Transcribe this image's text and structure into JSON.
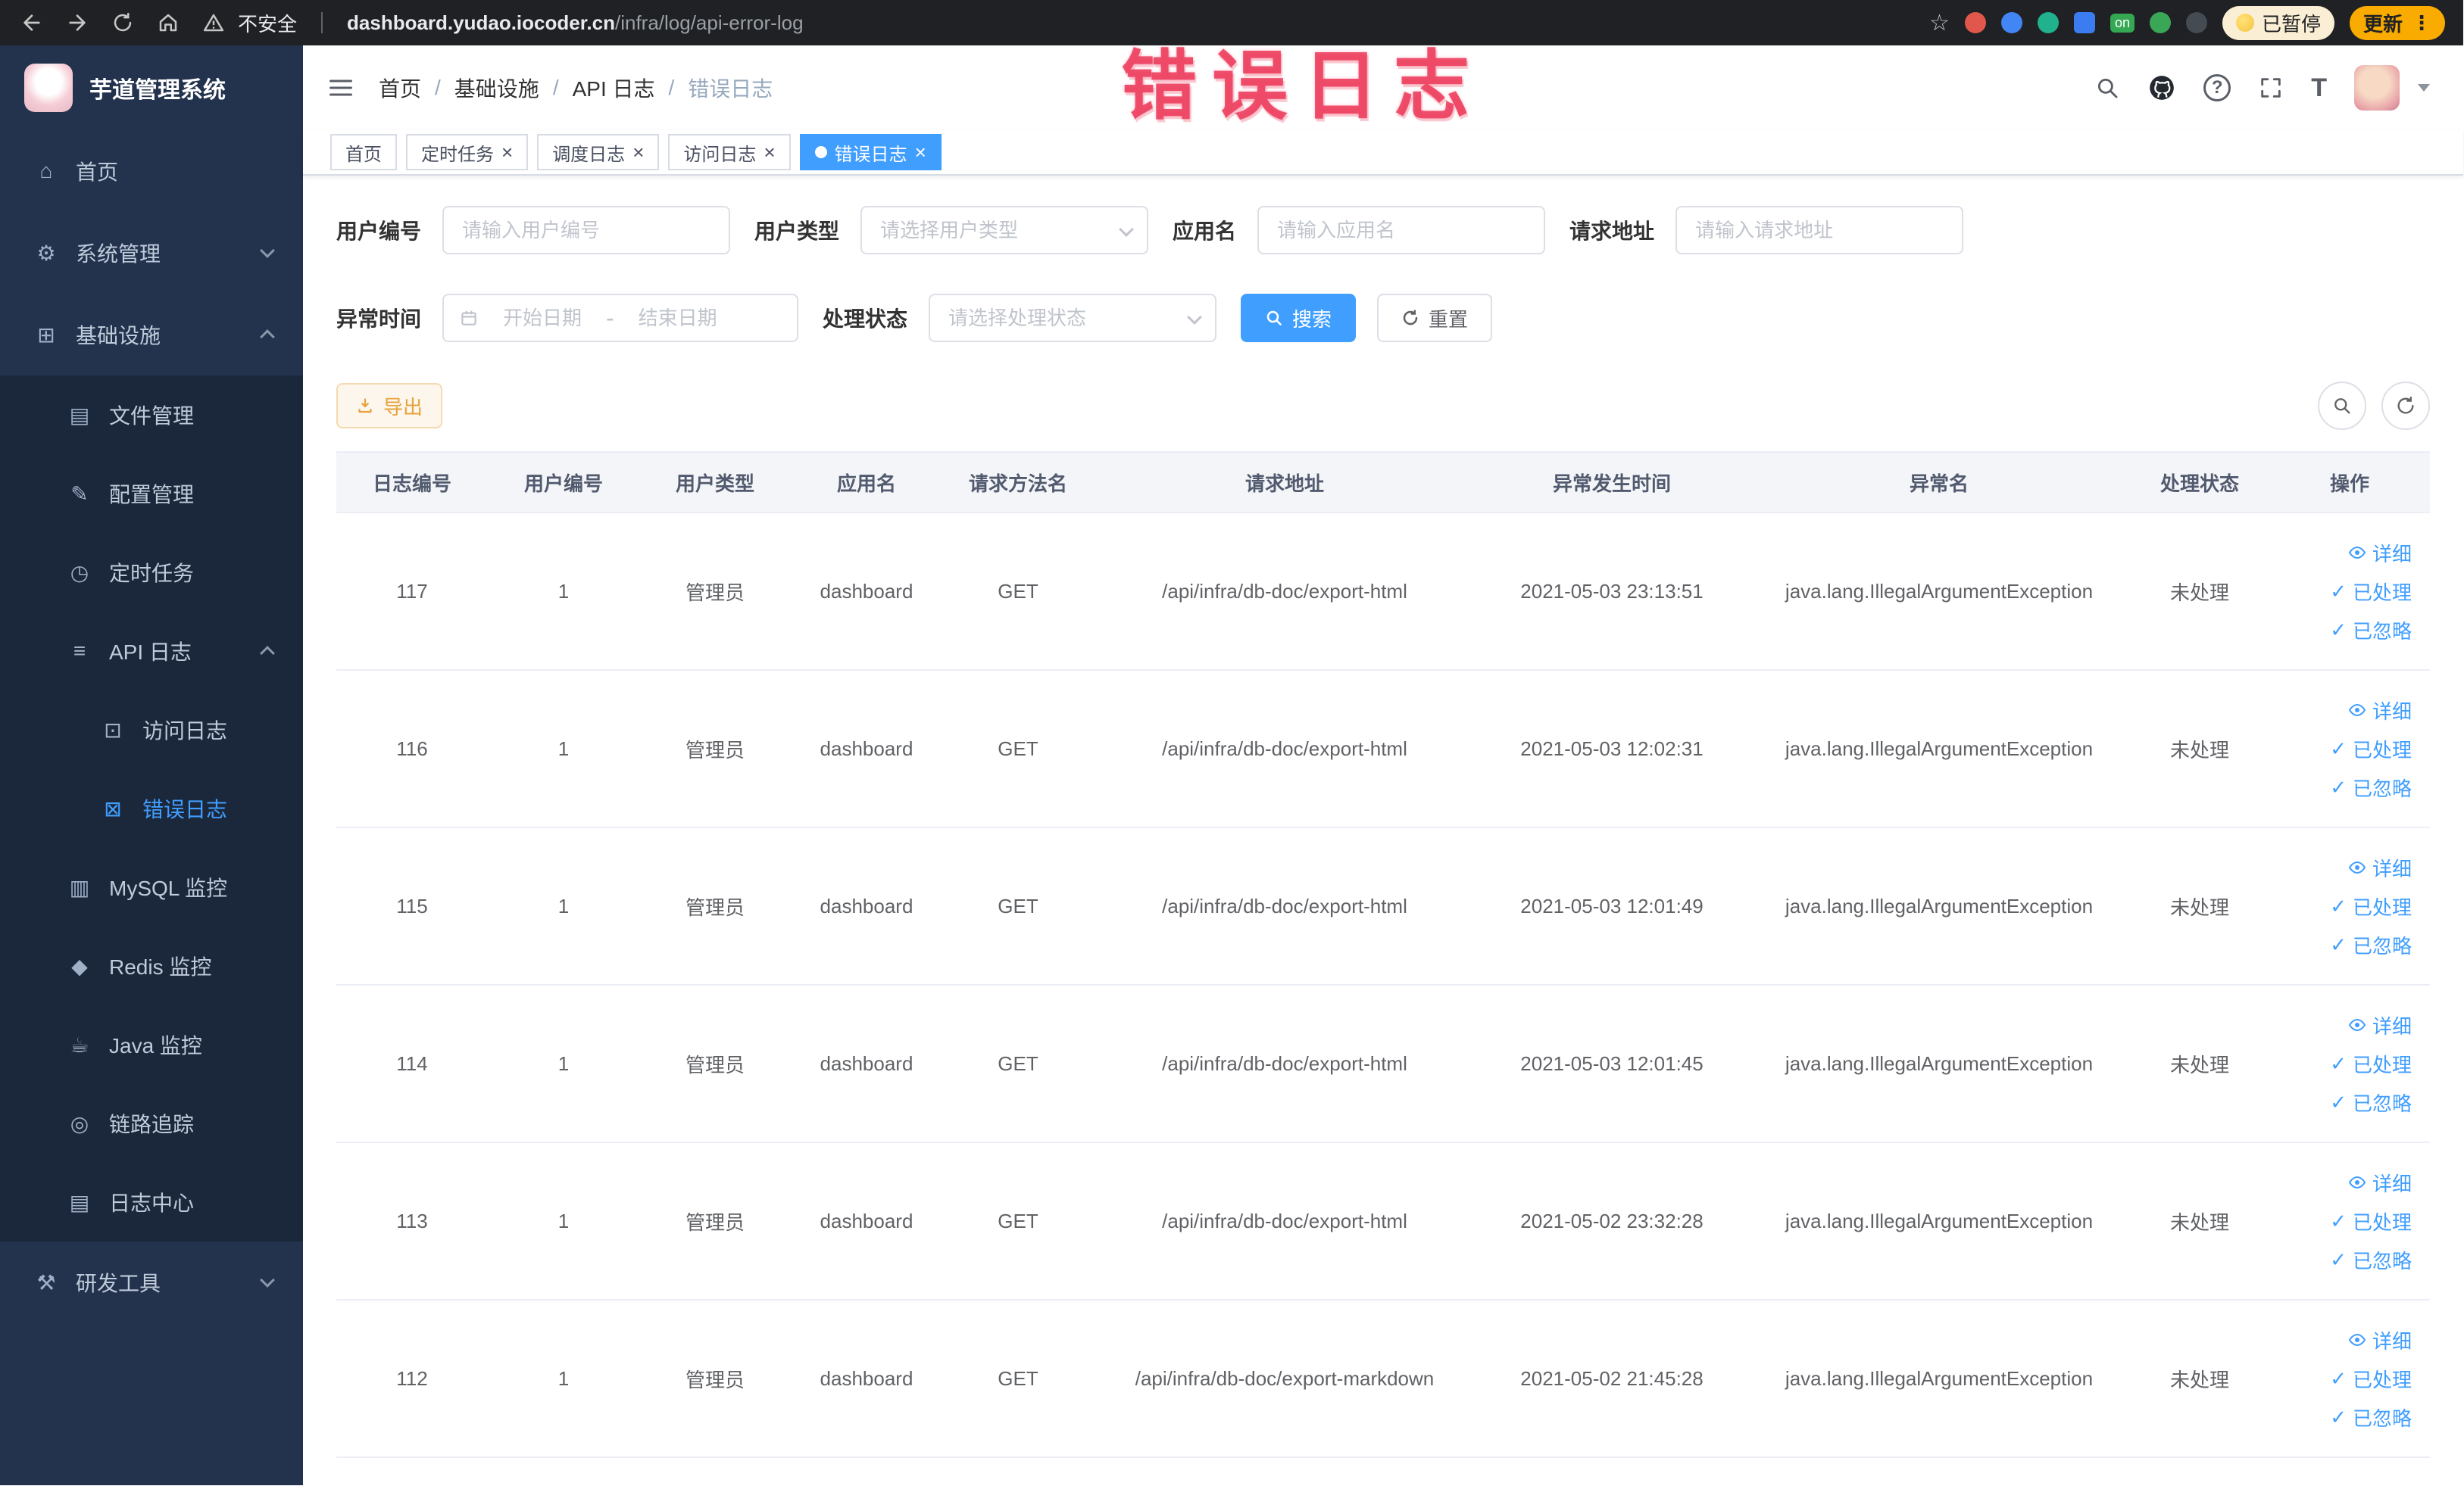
{
  "glyphs": {
    "star": "☆",
    "question": "?",
    "font_size": "T",
    "ellipsis": "⋮",
    "check": "✓"
  },
  "browser": {
    "security_label": "不安全",
    "url_domain": "dashboard.yudao.iocoder.cn",
    "url_path": "/infra/log/api-error-log",
    "ext_on_badge": "on",
    "paused_badge": "已暂停",
    "update_button": "更新"
  },
  "annotation": "错误日志",
  "sidebar": {
    "logo_title": "芋道管理系统",
    "home": "首页",
    "system_mgmt": "系统管理",
    "infra": "基础设施",
    "file_mgmt": "文件管理",
    "config_mgmt": "配置管理",
    "cron_job": "定时任务",
    "api_log": "API 日志",
    "access_log": "访问日志",
    "error_log": "错误日志",
    "mysql_monitor": "MySQL 监控",
    "redis_monitor": "Redis 监控",
    "java_monitor": "Java 监控",
    "tracing": "链路追踪",
    "log_center": "日志中心",
    "dev_tools": "研发工具"
  },
  "breadcrumb": {
    "separator": "/",
    "items": [
      "首页",
      "基础设施",
      "API 日志",
      "错误日志"
    ]
  },
  "tabs": {
    "close_glyph": "×",
    "items": [
      {
        "label": "首页"
      },
      {
        "label": "定时任务"
      },
      {
        "label": "调度日志"
      },
      {
        "label": "访问日志"
      },
      {
        "label": "错误日志"
      }
    ]
  },
  "filters": {
    "user_id_label": "用户编号",
    "user_id_placeholder": "请输入用户编号",
    "user_type_label": "用户类型",
    "user_type_placeholder": "请选择用户类型",
    "app_name_label": "应用名",
    "app_name_placeholder": "请输入应用名",
    "request_url_label": "请求地址",
    "request_url_placeholder": "请输入请求地址",
    "exception_time_label": "异常时间",
    "date_start_placeholder": "开始日期",
    "date_separator": "-",
    "date_end_placeholder": "结束日期",
    "process_status_label": "处理状态",
    "process_status_placeholder": "请选择处理状态",
    "search_button": "搜索",
    "reset_button": "重置"
  },
  "toolbar": {
    "export_button": "导出"
  },
  "table": {
    "columns": [
      "日志编号",
      "用户编号",
      "用户类型",
      "应用名",
      "请求方法名",
      "请求地址",
      "异常发生时间",
      "异常名",
      "处理状态",
      "操作"
    ],
    "actions": {
      "detail": "详细",
      "processed": "已处理",
      "ignored": "已忽略"
    },
    "rows": [
      {
        "id": "117",
        "user_id": "1",
        "user_type": "管理员",
        "app": "dashboard",
        "method": "GET",
        "url": "/api/infra/db-doc/export-html",
        "time": "2021-05-03 23:13:51",
        "exception": "java.lang.IllegalArgumentException",
        "status": "未处理"
      },
      {
        "id": "116",
        "user_id": "1",
        "user_type": "管理员",
        "app": "dashboard",
        "method": "GET",
        "url": "/api/infra/db-doc/export-html",
        "time": "2021-05-03 12:02:31",
        "exception": "java.lang.IllegalArgumentException",
        "status": "未处理"
      },
      {
        "id": "115",
        "user_id": "1",
        "user_type": "管理员",
        "app": "dashboard",
        "method": "GET",
        "url": "/api/infra/db-doc/export-html",
        "time": "2021-05-03 12:01:49",
        "exception": "java.lang.IllegalArgumentException",
        "status": "未处理"
      },
      {
        "id": "114",
        "user_id": "1",
        "user_type": "管理员",
        "app": "dashboard",
        "method": "GET",
        "url": "/api/infra/db-doc/export-html",
        "time": "2021-05-03 12:01:45",
        "exception": "java.lang.IllegalArgumentException",
        "status": "未处理"
      },
      {
        "id": "113",
        "user_id": "1",
        "user_type": "管理员",
        "app": "dashboard",
        "method": "GET",
        "url": "/api/infra/db-doc/export-html",
        "time": "2021-05-02 23:32:28",
        "exception": "java.lang.IllegalArgumentException",
        "status": "未处理"
      },
      {
        "id": "112",
        "user_id": "1",
        "user_type": "管理员",
        "app": "dashboard",
        "method": "GET",
        "url": "/api/infra/db-doc/export-markdown",
        "time": "2021-05-02 21:45:28",
        "exception": "java.lang.IllegalArgumentException",
        "status": "未处理"
      }
    ]
  }
}
